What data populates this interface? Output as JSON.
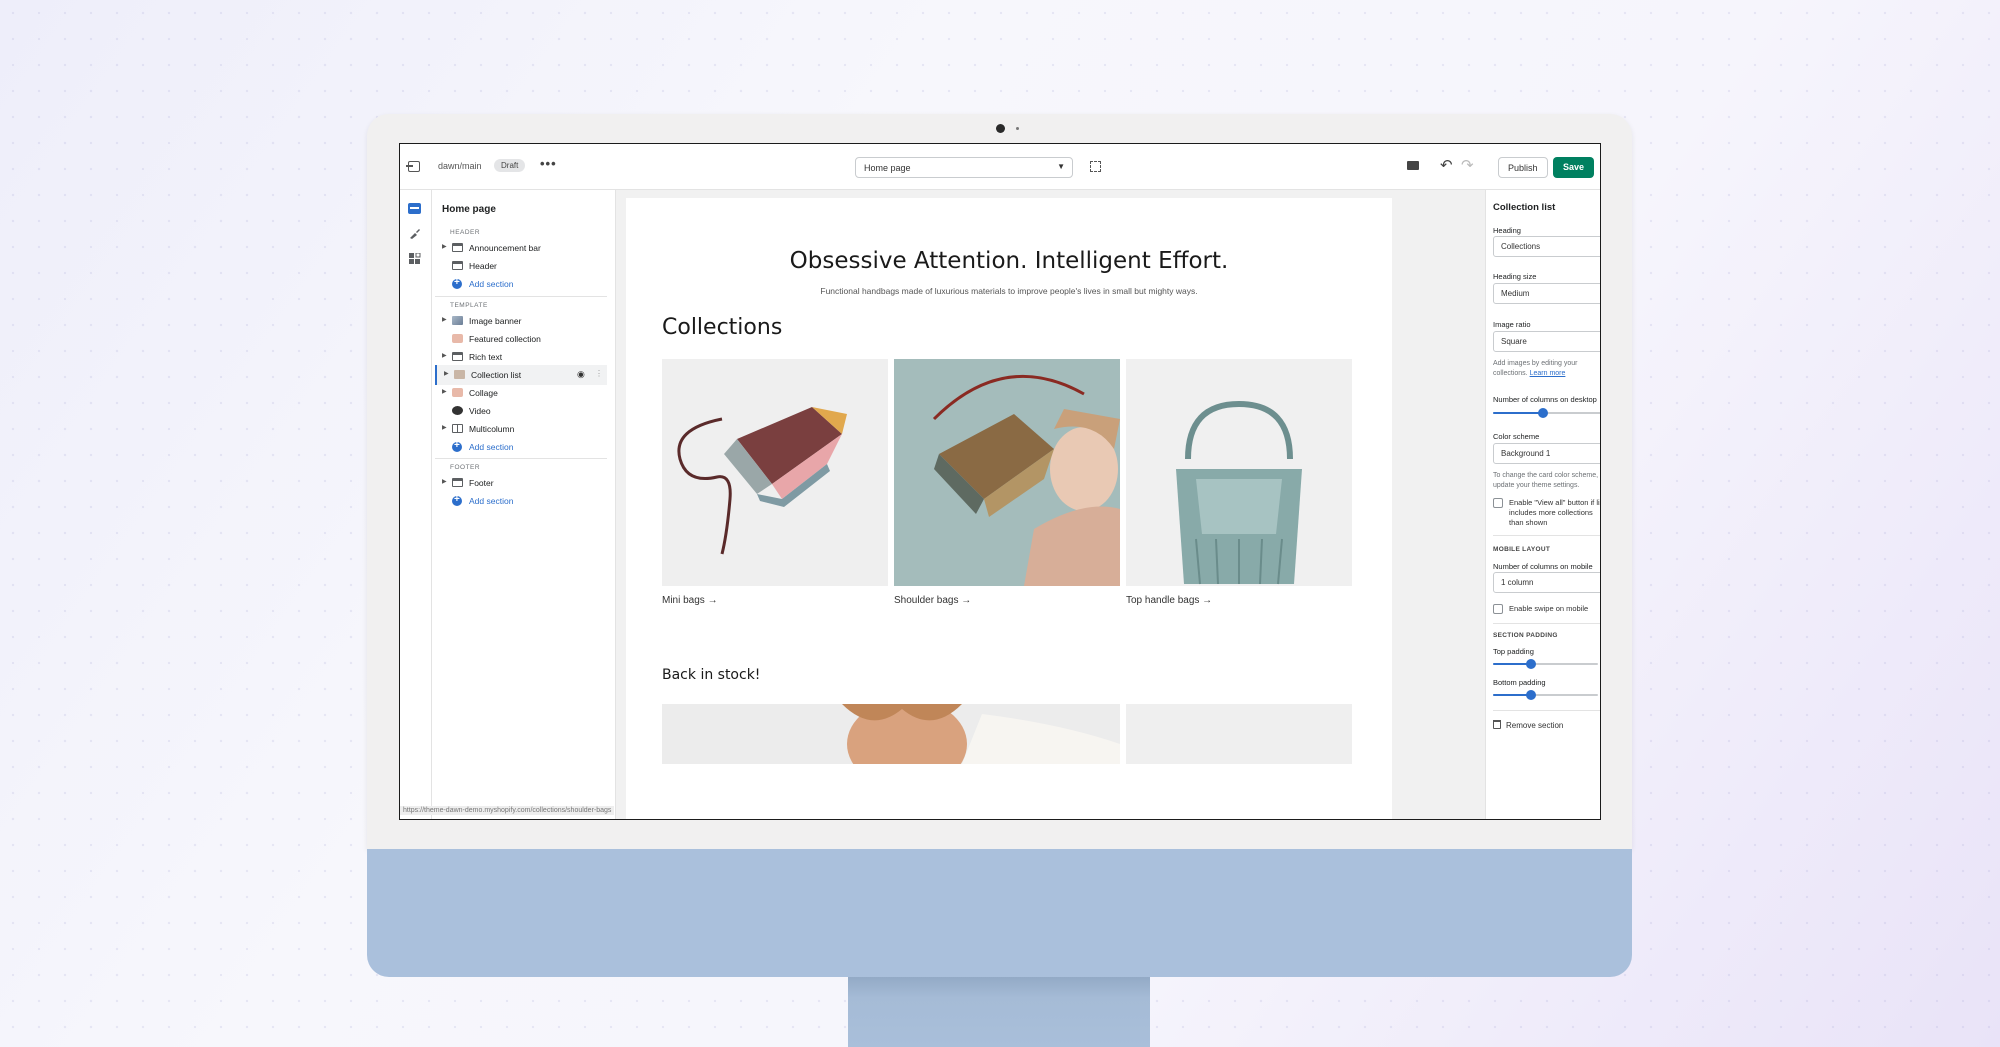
{
  "topbar": {
    "theme_name": "dawn/main",
    "badge": "Draft",
    "more": "•••",
    "page_select": "Home page",
    "publish_label": "Publish",
    "save_label": "Save"
  },
  "sidebar": {
    "title": "Home page",
    "groups": {
      "header": "HEADER",
      "template": "TEMPLATE",
      "footer": "FOOTER"
    },
    "header_items": [
      "Announcement bar",
      "Header",
      "Add section"
    ],
    "template_items": [
      "Image banner",
      "Featured collection",
      "Rich text",
      "Collection list",
      "Collage",
      "Video",
      "Multicolumn",
      "Add section"
    ],
    "footer_items": [
      "Footer",
      "Add section"
    ],
    "status_url": "https://theme-dawn-demo.myshopify.com/collections/shoulder-bags"
  },
  "preview": {
    "hero_title": "Obsessive Attention. Intelligent Effort.",
    "hero_subtitle": "Functional handbags made of luxurious materials to improve people's lives in small but mighty ways.",
    "collections_heading": "Collections",
    "cards": [
      "Mini bags →",
      "Shoulder bags →",
      "Top handle bags →"
    ],
    "back_in_stock": "Back in stock!"
  },
  "settings": {
    "title": "Collection list",
    "heading_label": "Heading",
    "heading_value": "Collections",
    "heading_size_label": "Heading size",
    "heading_size_value": "Medium",
    "image_ratio_label": "Image ratio",
    "image_ratio_value": "Square",
    "image_help": "Add images by editing your collections.",
    "learn_more": "Learn more",
    "columns_desktop_label": "Number of columns on desktop",
    "columns_desktop_value": "3",
    "columns_desktop_fraction": 0.45,
    "color_scheme_label": "Color scheme",
    "color_scheme_value": "Background 1",
    "color_help": "To change the card color scheme, update your theme settings.",
    "view_all_label": "Enable \"View all\" button if list includes more collections than shown",
    "mobile_layout_group": "MOBILE LAYOUT",
    "columns_mobile_label": "Number of columns on mobile",
    "columns_mobile_value": "1 column",
    "swipe_label": "Enable swipe on mobile",
    "section_padding_group": "SECTION PADDING",
    "top_padding_label": "Top padding",
    "top_padding_value": "36px",
    "top_padding_fraction": 0.36,
    "bottom_padding_label": "Bottom padding",
    "bottom_padding_value": "36px",
    "bottom_padding_fraction": 0.36,
    "remove_label": "Remove section"
  },
  "colors": {
    "accent": "#2c6ecb",
    "save": "#008060",
    "monitor_chin": "#aac0dc"
  }
}
